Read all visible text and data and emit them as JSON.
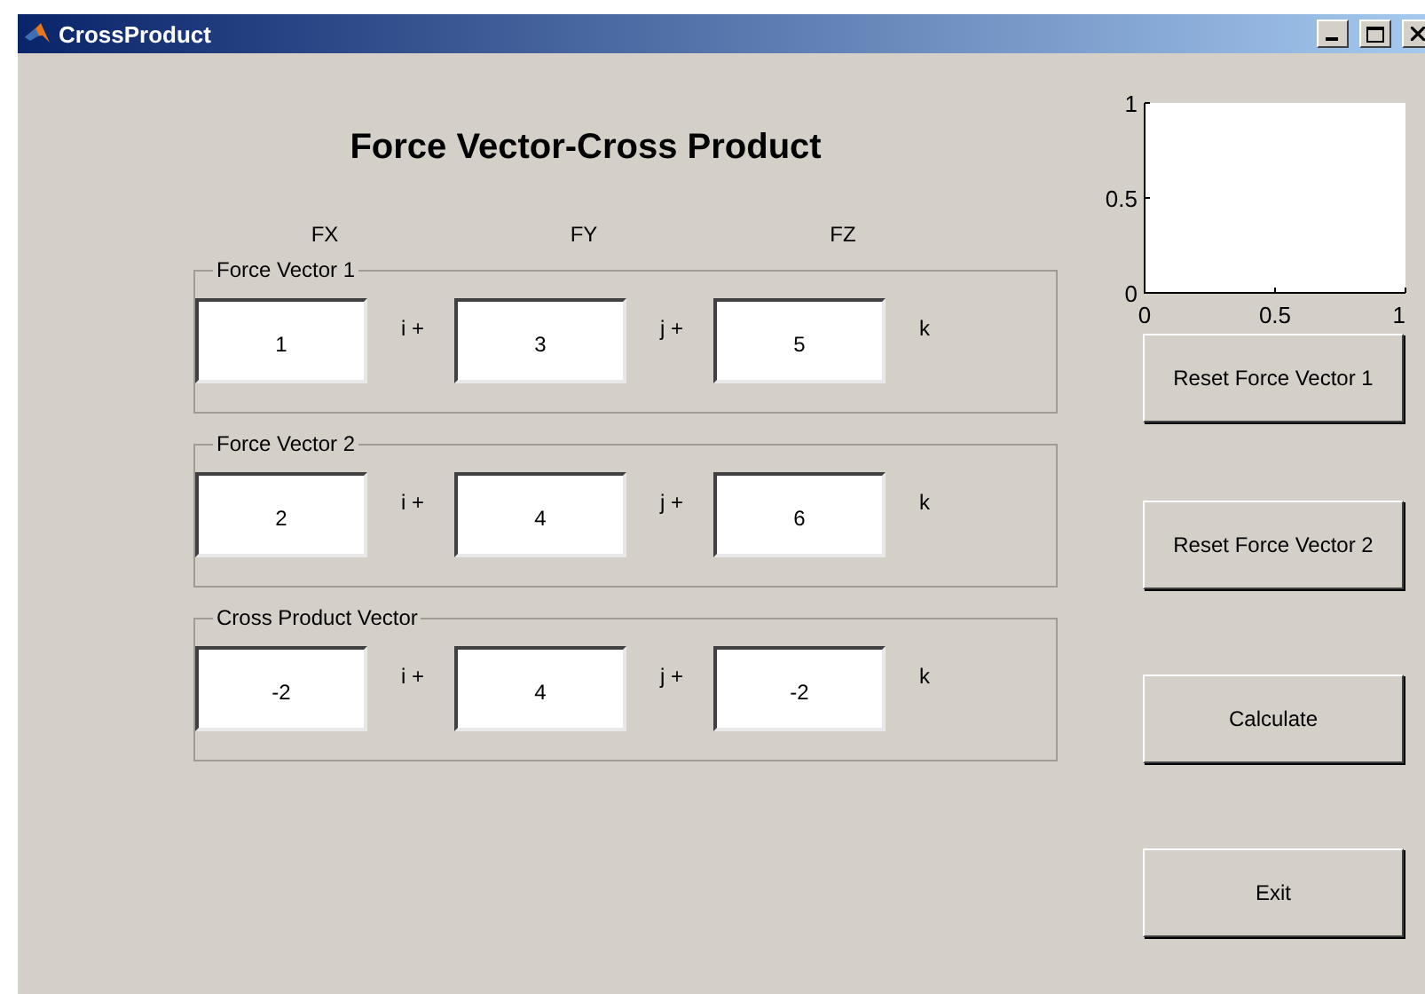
{
  "window": {
    "title": "CrossProduct"
  },
  "heading": "Force Vector-Cross Product",
  "column_headers": [
    "FX",
    "FY",
    "FZ"
  ],
  "panels": [
    {
      "title": "Force Vector 1",
      "components": [
        {
          "value": "1",
          "unit": "i +"
        },
        {
          "value": "3",
          "unit": "j +"
        },
        {
          "value": "5",
          "unit": "k"
        }
      ]
    },
    {
      "title": "Force Vector 2",
      "components": [
        {
          "value": "2",
          "unit": "i +"
        },
        {
          "value": "4",
          "unit": "j +"
        },
        {
          "value": "6",
          "unit": "k"
        }
      ]
    },
    {
      "title": "Cross Product Vector",
      "components": [
        {
          "value": "-2",
          "unit": "i +"
        },
        {
          "value": "4",
          "unit": "j +"
        },
        {
          "value": "-2",
          "unit": "k"
        }
      ]
    }
  ],
  "axes": {
    "chart_data": {
      "type": "line",
      "xlim": [
        0,
        1
      ],
      "ylim": [
        0,
        1
      ],
      "xticks": [
        {
          "value": 0,
          "label": "0"
        },
        {
          "value": 0.5,
          "label": "0.5"
        },
        {
          "value": 1,
          "label": "1"
        }
      ],
      "yticks": [
        {
          "value": 0,
          "label": "0"
        },
        {
          "value": 0.5,
          "label": "0.5"
        },
        {
          "value": 1,
          "label": "1"
        }
      ]
    }
  },
  "buttons": [
    "Reset Force Vector 1",
    "Reset Force Vector 2",
    "Calculate",
    "Exit"
  ]
}
